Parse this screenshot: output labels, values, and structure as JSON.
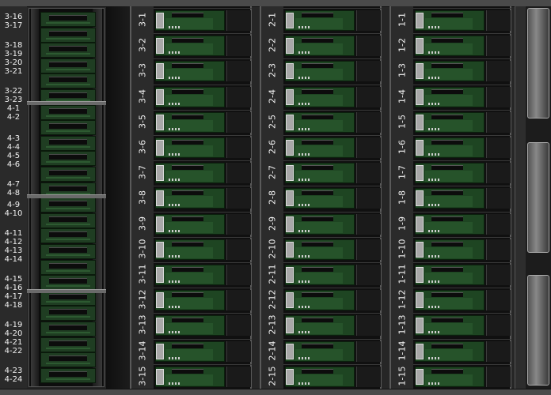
{
  "left_labels": [
    "3-16",
    "3-17",
    "3-18",
    "3-19",
    "3-20",
    "3-21",
    "3-22",
    "3-23",
    "4-1",
    "4-2",
    "4-3",
    "4-4",
    "4-5",
    "4-6",
    "4-7",
    "4-8",
    "4-9",
    "4-10",
    "4-11",
    "4-12",
    "4-13",
    "4-14",
    "4-15",
    "4-16",
    "4-17",
    "4-18",
    "4-19",
    "4-20",
    "4-21",
    "4-22",
    "4-23",
    "4-24"
  ],
  "bays": [
    {
      "id": "bay-3",
      "slots": [
        "3-1",
        "3-2",
        "3-3",
        "3-4",
        "3-5",
        "3-6",
        "3-7",
        "3-8",
        "3-9",
        "3-10",
        "3-11",
        "3-12",
        "3-13",
        "3-14",
        "3-15"
      ]
    },
    {
      "id": "bay-2",
      "slots": [
        "2-1",
        "2-2",
        "2-3",
        "2-4",
        "2-5",
        "2-6",
        "2-7",
        "2-8",
        "2-9",
        "2-10",
        "2-11",
        "2-12",
        "2-13",
        "2-14",
        "2-15"
      ]
    },
    {
      "id": "bay-1",
      "slots": [
        "1-1",
        "1-2",
        "1-3",
        "1-4",
        "1-5",
        "1-6",
        "1-7",
        "1-8",
        "1-9",
        "1-10",
        "1-11",
        "1-12",
        "1-13",
        "1-14",
        "1-15"
      ]
    }
  ],
  "colors": {
    "pcb": "#1e4522",
    "handle": "#a8a8a8",
    "label": "#f2f2f2",
    "chassis": "#262626"
  }
}
